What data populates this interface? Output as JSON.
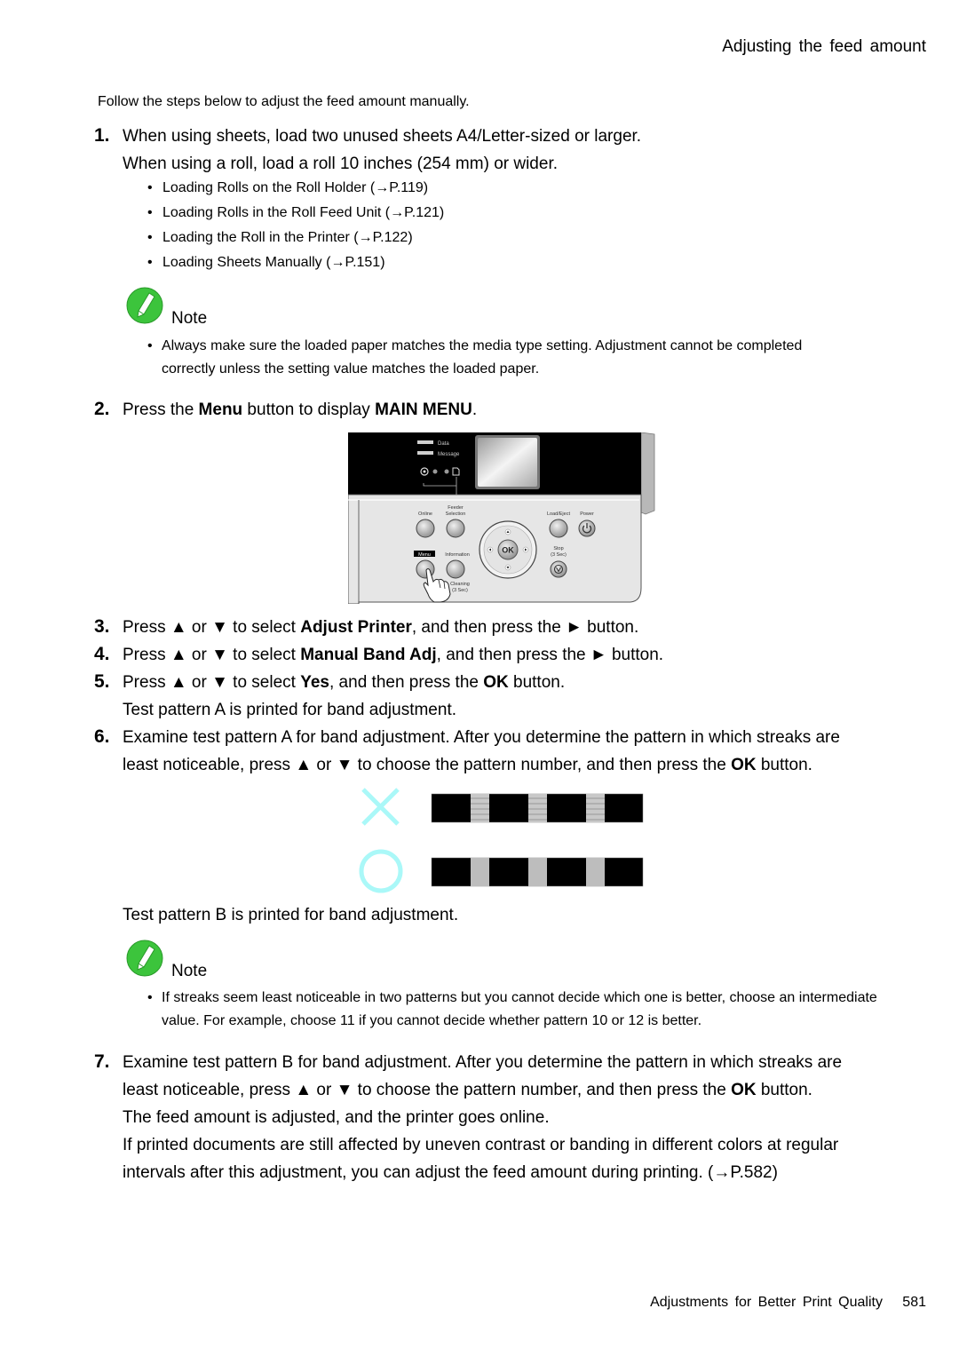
{
  "header": {
    "title": "Adjusting the feed amount"
  },
  "intro": "Follow the steps below to adjust the feed amount manually.",
  "step1": {
    "num": "1.",
    "line1": "When using sheets, load two unused sheets A4/Letter-sized or larger.",
    "line2": "When using a roll, load a roll 10 inches (254 mm) or wider.",
    "links": [
      {
        "text": "Loading Rolls on the Roll Holder (→P.119)"
      },
      {
        "text": "Loading Rolls in the Roll Feed Unit (→P.121)"
      },
      {
        "text": "Loading the Roll in the Printer (→P.122)"
      },
      {
        "text": "Loading Sheets Manually (→P.151)"
      }
    ],
    "note": {
      "label": "Note",
      "text": "Always make sure the loaded paper matches the media type setting. Adjustment cannot be completed correctly unless the setting value matches the loaded paper."
    }
  },
  "step2": {
    "num": "2.",
    "pre": "Press the ",
    "bold1": "Menu",
    "mid": " button to display ",
    "bold2": "MAIN MENU",
    "post": "."
  },
  "panel": {
    "labels": {
      "data": "Data",
      "message": "Message",
      "feeder": "Feeder",
      "selection": "Selection",
      "online": "Online",
      "load_eject": "Load/Eject",
      "power": "Power",
      "menu": "Menu",
      "information": "Information",
      "stop": "Stop",
      "stop_sub": "(3 Sec)",
      "cleaning": "Cleaning",
      "cleaning_sub": "(3 Sec)",
      "ok": "OK"
    }
  },
  "step3": {
    "num": "3.",
    "pre": "Press ▲ or ▼ to select ",
    "bold": "Adjust Printer",
    "post": ", and then press the ► button."
  },
  "step4": {
    "num": "4.",
    "pre": "Press ▲ or ▼ to select ",
    "bold": "Manual Band Adj",
    "post": ", and then press the ► button."
  },
  "step5": {
    "num": "5.",
    "pre": "Press ▲ or ▼ to select ",
    "bold1": "Yes",
    "mid": ", and then press the ",
    "bold2": "OK",
    "post": " button.",
    "line2": "Test pattern A is printed for band adjustment."
  },
  "step6": {
    "num": "6.",
    "line1": "Examine test pattern A for band adjustment.  After you determine the pattern in which streaks are",
    "line2_pre": "least noticeable, press ▲ or ▼ to choose the pattern number, and then press the ",
    "line2_bold": "OK",
    "line2_post": " button.",
    "after": "Test pattern B is printed for band adjustment.",
    "note": {
      "label": "Note",
      "text": "If streaks seem least noticeable in two patterns but you cannot decide which one is better, choose an intermediate value.  For example, choose 11 if you cannot decide whether pattern 10 or 12 is better."
    }
  },
  "step7": {
    "num": "7.",
    "line1": "Examine test pattern B for band adjustment.  After you determine the pattern in which streaks are",
    "line2_pre": "least noticeable, press ▲ or ▼ to choose the pattern number, and then press the ",
    "line2_bold": "OK",
    "line2_post": " button.",
    "line3": "The feed amount is adjusted, and the printer goes online.",
    "line4": "If printed documents are still affected by uneven contrast or banding in different colors at regular",
    "line5": "intervals after this adjustment, you can adjust the feed amount during printing.  (→P.582)"
  },
  "patterns": {
    "bad_mark": "cross-mark",
    "good_mark": "circle-mark",
    "mark_color": "#aaf8f8"
  },
  "footer": {
    "section": "Adjustments for Better Print Quality",
    "page": "581"
  },
  "colors": {
    "note_green": "#3cc43c"
  }
}
